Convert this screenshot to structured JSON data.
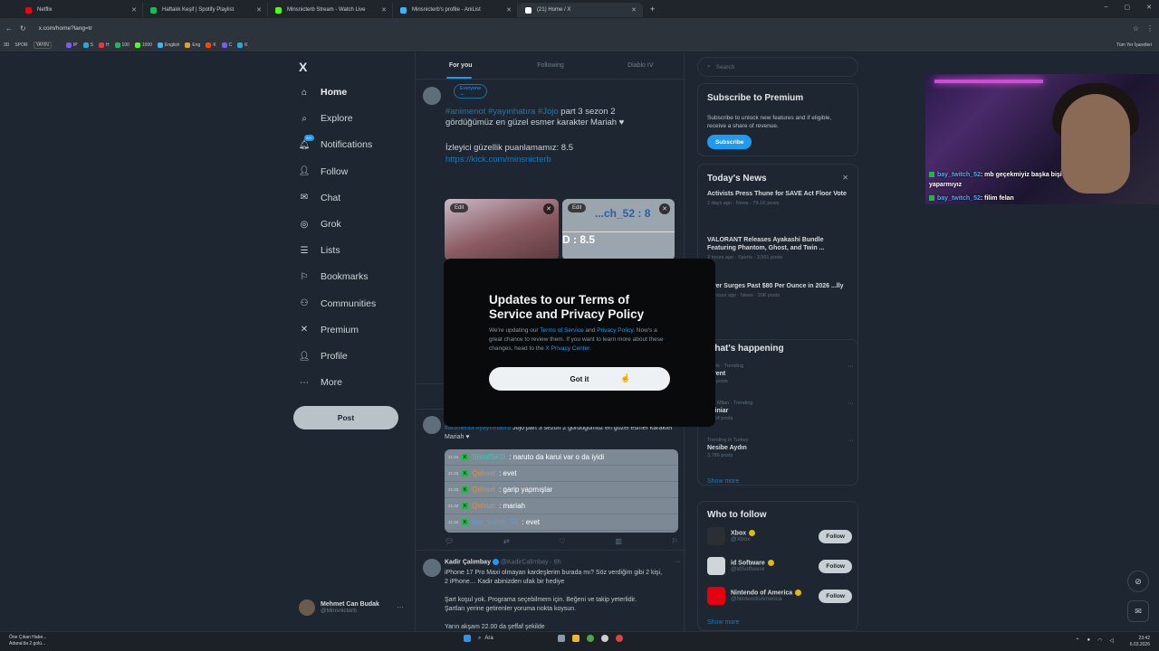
{
  "browser": {
    "tabs": [
      {
        "label": "Netflix",
        "color": "#e50914"
      },
      {
        "label": "Haftalık Keşif | Spotify Playlist",
        "color": "#1db954",
        "badge": "YAYIN"
      },
      {
        "label": "Minsnicterb Stream - Watch Live",
        "color": "#53fc18"
      },
      {
        "label": "Minsnicterb's profile - AniList",
        "color": "#3db4f2"
      },
      {
        "label": "(21) Home / X",
        "color": "#ffffff"
      }
    ],
    "url": "x.com/home?lang=tr",
    "bookmarks_start": [
      "3D",
      "SPOR",
      "YAYIN"
    ],
    "bookmarks_mid": [
      "IP",
      "S",
      "H",
      "100",
      "1000",
      "English",
      "Eng",
      "K",
      "C",
      "K"
    ],
    "bookmarks_end": "Tüm Yer İşaretleri"
  },
  "nav": {
    "logo": "X",
    "items": [
      {
        "label": "Home",
        "icon": "home-icon"
      },
      {
        "label": "Explore",
        "icon": "search-icon"
      },
      {
        "label": "Notifications",
        "icon": "bell-icon",
        "badge": "20+"
      },
      {
        "label": "Follow",
        "icon": "follow-icon"
      },
      {
        "label": "Chat",
        "icon": "chat-icon"
      },
      {
        "label": "Grok",
        "icon": "grok-icon"
      },
      {
        "label": "Lists",
        "icon": "list-icon"
      },
      {
        "label": "Bookmarks",
        "icon": "bookmark-icon"
      },
      {
        "label": "Communities",
        "icon": "communities-icon"
      },
      {
        "label": "Premium",
        "icon": "x-icon"
      },
      {
        "label": "Profile",
        "icon": "profile-icon"
      },
      {
        "label": "More",
        "icon": "more-icon"
      }
    ],
    "post_label": "Post",
    "user": {
      "name": "Mehmet Can Budak",
      "handle": "@Minsnicterb"
    }
  },
  "timeline": {
    "tabs": [
      "For you",
      "Following",
      "Diablo IV"
    ],
    "everyone_label": "Everyone",
    "compose_tags": "#animenot #yayınhatıra #Jojo",
    "compose_line1_rest": " part 3 sezon 2",
    "compose_line2": "gördüğümüz en güzel esmer karakter Mariah ♥",
    "compose_rating": "İzleyici güzellik puanlamamız: 8.5",
    "compose_link": "https://kick.com/minsnicterb",
    "edit_label": "Edit",
    "tile2_line1": "...ch_52 : 8",
    "tile2_line2": "D : 8.5",
    "tweet1_tags": "#animenot #yayınhatıra",
    "tweet1_text": " Jojo part 3 sezon 2 gördüğümüz en güzel esmer karakter Mariah ♥",
    "chat": [
      {
        "time": "21:33",
        "user": "ShmifSKD",
        "msg": ": naruto da karui var o da iyidi",
        "cls": "u1"
      },
      {
        "time": "21:33",
        "user": "Qehset",
        "msg": ": evet",
        "cls": "u2"
      },
      {
        "time": "21:33",
        "user": "Qehset",
        "msg": ": garip yapmışlar",
        "cls": "u2"
      },
      {
        "time": "21:33",
        "user": "Qehset",
        "msg": ": mariah",
        "cls": "u2"
      },
      {
        "time": "21:33",
        "user": "bay_twitch_52",
        "msg": ": evet",
        "cls": "u3"
      }
    ],
    "tweet2": {
      "name": "Kadir Çalımbay",
      "handle": "@KadirCalimbay · 6h",
      "lines": [
        "iPhone 17 Pro Maxi olmayan kardeşlerim burada mı? Söz verdiğim gibi 2 kişi,",
        "2 iPhone… Kadir abinizden ufak bir hediye",
        "",
        "Şart koşul yok. Programa seçebilmem için. Beğeni ve takip yeterlidir.",
        "Şartları yerine getirenler yoruma nokta koysun.",
        "",
        "Yarın akşam 22.00 da şeffaf şekilde"
      ]
    }
  },
  "sidebar": {
    "search_placeholder": "Search",
    "premium": {
      "title": "Subscribe to Premium",
      "text": "Subscribe to unlock new features and if eligible, receive a share of revenue.",
      "button": "Subscribe"
    },
    "news_title": "Today's News",
    "news": [
      {
        "headline": "Activists Press Thune for SAVE Act Floor Vote",
        "meta": "2 days ago · News · 79.1K posts"
      },
      {
        "headline": "VALORANT Releases Ayakashi Bundle Featuring Phantom, Ghost, and Twin ...",
        "meta": "3 hours ago · Sports · 3,561 posts"
      },
      {
        "headline": "...ver Surges Past $80 Per Ounce in 2026 ...lly",
        "meta": "21 hours ago · News · 20K posts"
      }
    ],
    "happening_title": "...hat's happening",
    "trends": [
      {
        "category": "...orts · Trending",
        "name": "...vent",
        "posts": "...K posts"
      },
      {
        "category": "...er Milan · Trending",
        "name": "...riniar",
        "posts": "1,964 posts"
      },
      {
        "category": "Trending in Turkey",
        "name": "Nesibe Aydın",
        "posts": "3,786 posts"
      }
    ],
    "show_more": "Show more",
    "wtf_title": "Who to follow",
    "wtf": [
      {
        "name": "Xbox",
        "handle": "@Xbox",
        "color": "#2b2f33"
      },
      {
        "name": "id Software",
        "handle": "@idSoftware",
        "color": "#d0d5d9"
      },
      {
        "name": "Nintendo of America",
        "handle": "@NintendoAmerica",
        "color": "#e4000f"
      }
    ],
    "follow_label": "Follow"
  },
  "modal": {
    "title": "Updates to our Terms of Service and Privacy Policy",
    "body_pre": "We're updating our ",
    "link1": "Terms of Service",
    "and": " and ",
    "link2": "Privacy Policy",
    "body_mid": ". Now's a great chance to review them. If you want to learn more about these changes, head to the ",
    "link3": "X Privacy Center",
    "body_end": ".",
    "button": "Got it"
  },
  "webcam": {
    "lines": [
      {
        "user": "bay_twitch_52",
        "msg": ": mb geçekmiyiz başka bişi yaparmıyız"
      },
      {
        "user": "bay_twitch_52",
        "msg": ": filim felan"
      }
    ]
  },
  "taskbar": {
    "news_title": "Öne Çıkan Habe...",
    "news_sub": "Adana'da 2 golü...",
    "search": "Ara",
    "time": "23:42",
    "date": "6.03.2026"
  }
}
